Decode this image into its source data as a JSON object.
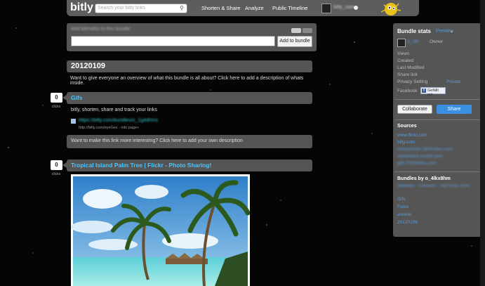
{
  "header": {
    "logo": "bitly",
    "search_placeholder": "Search your bitly links",
    "nav": [
      "Shorten & Share",
      "Analyze",
      "Public Timeline"
    ],
    "username": "bitly_user"
  },
  "add_bar": {
    "title": "Add bitmarks to this bundle",
    "button": "Add to bundle"
  },
  "bundle": {
    "name": "20120109",
    "description_prompt": "Want to give everyone an overview of what this bundle is all about? Click here to add a description of whats inside."
  },
  "links": [
    {
      "clicks": "0",
      "clicks_label": "clicks",
      "title": "Gifs",
      "description": "bitly, shorten, share and track your links",
      "short_url": "https://bitly.com/bundles/o_1g4dhms",
      "source": "http://bitly.com/eyeGes - info page+",
      "note_prompt": "Want to make this link more interesting? Click here to add your own description"
    },
    {
      "clicks": "0",
      "clicks_label": "clicks",
      "title": "Tropical Island Palm Tree | Flickr - Photo Sharing!"
    }
  ],
  "sidebar": {
    "title": "Bundle stats",
    "preview": "Preview",
    "owner_name": "o_4lk",
    "owner_role": "Owner",
    "stats": [
      "Views",
      "Created",
      "Last Modified",
      "Share link",
      "Privacy Setting"
    ],
    "privacy_value": "Private",
    "facebook_label": "Facebook",
    "facebook_button": "Gefällt mir",
    "collaborate": "Collaborate",
    "share": "Share",
    "sources_title": "Sources",
    "sources": [
      "www.flickr.com",
      "bitly.com",
      "fontcost16x.1800miles.com",
      "stoneblack.tumblr.com",
      "gifs.7000miles.com"
    ],
    "bundles_title": "Bundles by o_4lkx8hm",
    "bundles_sub": "3Bundles · Followers · and much more",
    "bundle_list": [
      "Gifs",
      "Fotos",
      "andere",
      "20120109"
    ]
  },
  "colors": {
    "accent": "#4bc4ff",
    "panel": "#555555",
    "share": "#3b8fe0"
  }
}
